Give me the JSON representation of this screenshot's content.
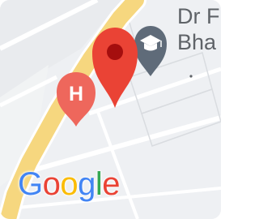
{
  "map": {
    "place_label_line1": "Dr F",
    "place_label_line2": "Bha",
    "hospital_marker_letter": "H",
    "attribution_letters": [
      "G",
      "o",
      "o",
      "g",
      "l",
      "e"
    ]
  },
  "colors": {
    "map_background": "#eef0f3",
    "road_white": "#ffffff",
    "highway_yellow": "#f6d77f",
    "building_grey": "#dfe1e5",
    "pin_red": "#ea4335",
    "pin_center_dark": "#a50e0e",
    "hospital_marker": "#ee675c",
    "school_marker": "#5f6b79",
    "label_grey": "#5f6368",
    "google_blue": "#4285f4",
    "google_red": "#ea4335",
    "google_yellow": "#fbbc05",
    "google_green": "#34a853"
  },
  "icons": {
    "location_pin": "red-location-pin-icon",
    "hospital": "hospital-marker-icon",
    "school": "graduation-cap-marker-icon"
  }
}
